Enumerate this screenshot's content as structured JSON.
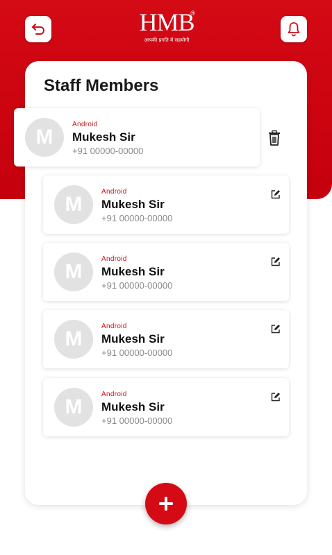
{
  "header": {
    "logo_text": "HMB",
    "logo_registered": "®",
    "logo_tagline": "आपकी प्रगति में सहयोगी",
    "back_icon": "back-arrow-icon",
    "notification_icon": "bell-icon",
    "brand_color": "#d40a15"
  },
  "page": {
    "title": "Staff Members"
  },
  "staff": [
    {
      "avatar_letter": "M",
      "role": "Android",
      "name": "Mukesh Sir",
      "phone": "+91 00000-00000",
      "action_icon": "trash-icon"
    },
    {
      "avatar_letter": "M",
      "role": "Android",
      "name": "Mukesh Sir",
      "phone": "+91 00000-00000",
      "action_icon": "edit-icon"
    },
    {
      "avatar_letter": "M",
      "role": "Android",
      "name": "Mukesh Sir",
      "phone": "+91 00000-00000",
      "action_icon": "edit-icon"
    },
    {
      "avatar_letter": "M",
      "role": "Android",
      "name": "Mukesh Sir",
      "phone": "+91 00000-00000",
      "action_icon": "edit-icon"
    },
    {
      "avatar_letter": "M",
      "role": "Android",
      "name": "Mukesh Sir",
      "phone": "+91 00000-00000",
      "action_icon": "edit-icon"
    }
  ],
  "fab": {
    "icon": "plus-icon",
    "label": "+"
  }
}
